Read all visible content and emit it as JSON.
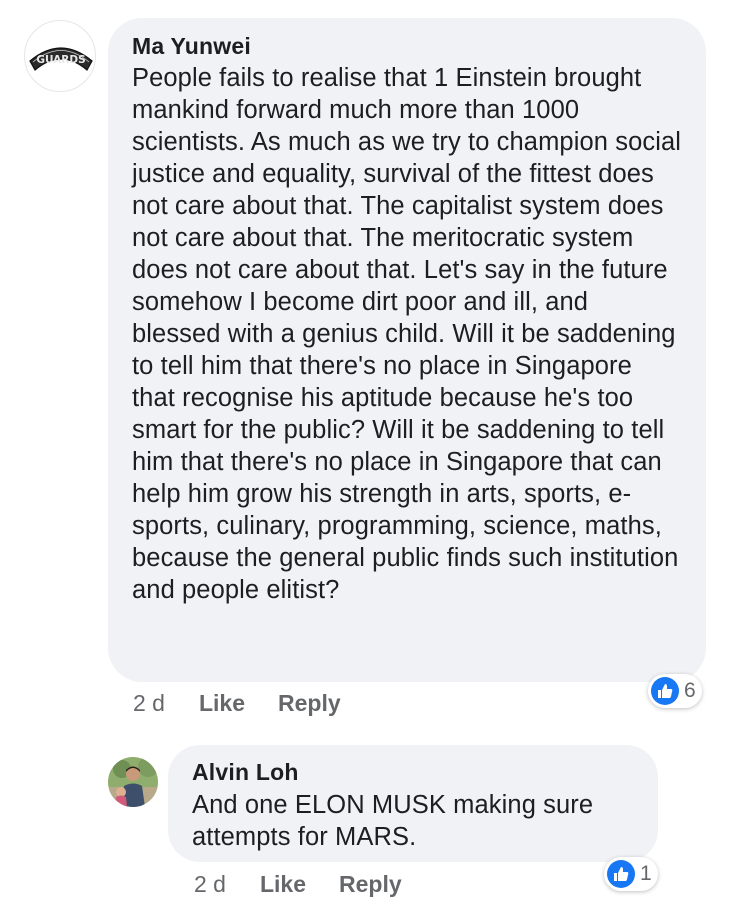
{
  "comment": {
    "author": "Ma Yunwei",
    "avatar_text": "GUARDS",
    "avatar_icon": "guards-badge-icon",
    "text": "People fails to realise that 1 Einstein brought mankind forward much more than 1000 scientists. As much as we try to champion social justice and equality, survival of the fittest does not care about that. The capitalist system does not care about that. The meritocratic system does not care about that. Let's say in the future somehow I become dirt poor and ill, and blessed with a genius child. Will it be saddening to tell him that there's no place in Singapore that recognise his aptitude because he's too smart for the public? Will it be saddening to tell him that there's no place in Singapore that can help him grow his strength in arts, sports, e-sports, culinary, programming, science, maths, because the general public finds such institution and people elitist?",
    "time": "2 d",
    "like_label": "Like",
    "reply_label": "Reply",
    "reaction_icon": "thumbs-up-icon",
    "reaction_count": "6"
  },
  "reply": {
    "author": "Alvin Loh",
    "avatar_icon": "user-photo-avatar",
    "text": "And one ELON MUSK making sure attempts for MARS.",
    "time": "2 d",
    "like_label": "Like",
    "reply_label": "Reply",
    "reaction_icon": "thumbs-up-icon",
    "reaction_count": "1"
  },
  "colors": {
    "bubble": "#f0f2f5",
    "text": "#1c1e21",
    "meta": "#65676b",
    "like_blue": "#1877f2"
  }
}
